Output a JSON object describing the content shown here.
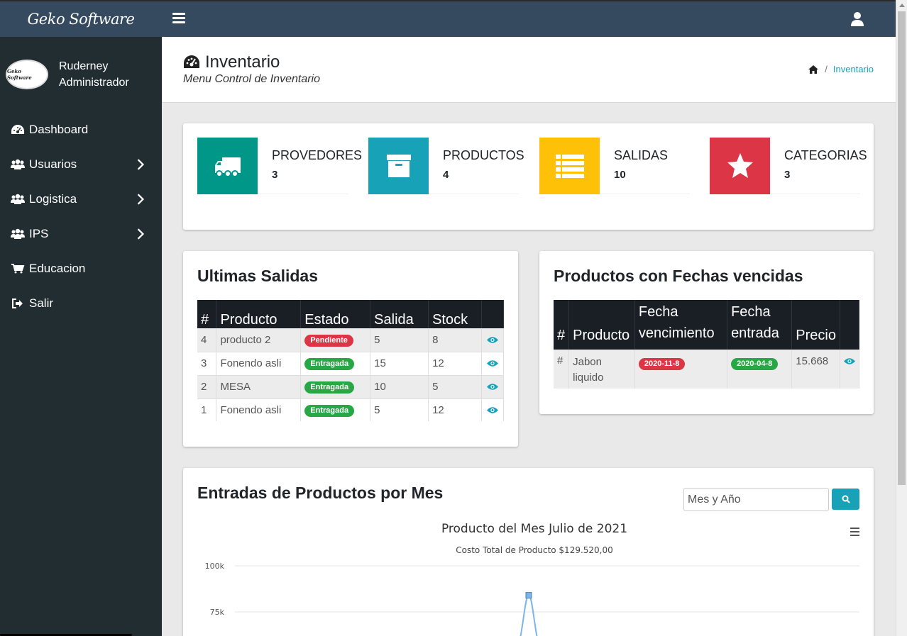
{
  "app": {
    "brand": "Geko Software"
  },
  "sidebar": {
    "user_name": "Ruderney",
    "user_role": "Administrador",
    "avatar_text": "Geko Software",
    "items": [
      {
        "label": "Dashboard",
        "icon": "dashboard-icon",
        "has_children": false
      },
      {
        "label": "Usuarios",
        "icon": "users-icon",
        "has_children": true
      },
      {
        "label": "Logistica",
        "icon": "users-icon",
        "has_children": true
      },
      {
        "label": "IPS",
        "icon": "users-icon",
        "has_children": true
      },
      {
        "label": "Educacion",
        "icon": "cart-icon",
        "has_children": false
      },
      {
        "label": "Salir",
        "icon": "sign-out-icon",
        "has_children": false
      }
    ]
  },
  "header": {
    "title": "Inventario",
    "subtitle": "Menu Control de Inventario",
    "breadcrumb": "Inventario"
  },
  "stats": [
    {
      "label": "PROVEDORES",
      "value": "3",
      "color": "#009688",
      "icon": "truck-icon"
    },
    {
      "label": "PRODUCTOS",
      "value": "4",
      "color": "#17a2b8",
      "icon": "archive-icon"
    },
    {
      "label": "SALIDAS",
      "value": "10",
      "color": "#ffc107",
      "icon": "list-icon"
    },
    {
      "label": "CATEGORIAS",
      "value": "3",
      "color": "#dc3545",
      "icon": "star-icon"
    }
  ],
  "salidas": {
    "title": "Ultimas Salidas",
    "headers": [
      "#",
      "Producto",
      "Estado",
      "Salida",
      "Stock",
      ""
    ],
    "rows": [
      {
        "num": "4",
        "producto": "producto 2",
        "estado": "Pendiente",
        "estado_color": "#dc3545",
        "salida": "5",
        "stock": "8"
      },
      {
        "num": "3",
        "producto": "Fonendo asli",
        "estado": "Entragada",
        "estado_color": "#28a745",
        "salida": "15",
        "stock": "12"
      },
      {
        "num": "2",
        "producto": "MESA",
        "estado": "Entragada",
        "estado_color": "#28a745",
        "salida": "10",
        "stock": "5"
      },
      {
        "num": "1",
        "producto": "Fonendo asli",
        "estado": "Entragada",
        "estado_color": "#28a745",
        "salida": "5",
        "stock": "12"
      }
    ]
  },
  "vencidas": {
    "title": "Productos con Fechas vencidas",
    "headers": [
      "#",
      "Producto",
      "Fecha vencimiento",
      "Fecha entrada",
      "Precio",
      ""
    ],
    "rows": [
      {
        "num": "#",
        "producto": "Jabon liquido",
        "vencimiento": "2020-11-8",
        "entrada": "2020-04-8",
        "precio": "15.668"
      }
    ]
  },
  "entradas": {
    "title": "Entradas de Productos por Mes",
    "search_placeholder": "Mes y Año"
  },
  "chart_data": {
    "type": "line",
    "title": "Producto del Mes Julio de 2021",
    "subtitle": "Costo Total de Producto $129.520,00",
    "y_ticks": [
      "100k",
      "75k"
    ],
    "series": [
      {
        "points": [
          {
            "y": 84000
          }
        ]
      }
    ],
    "series_color": "#7cb5ec"
  }
}
